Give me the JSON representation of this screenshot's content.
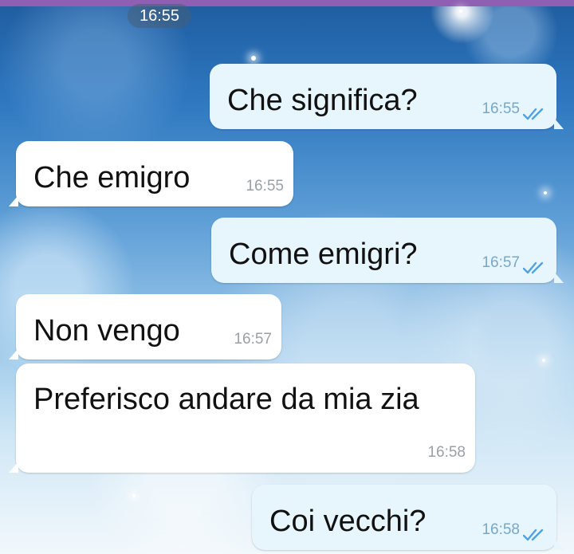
{
  "date_pill": "16:55",
  "messages": [
    {
      "text": "Che significa?",
      "time": "16:55",
      "direction": "out",
      "status": "read"
    },
    {
      "text": "Che emigro",
      "time": "16:55",
      "direction": "in"
    },
    {
      "text": "Come emigri?",
      "time": "16:57",
      "direction": "out",
      "status": "read"
    },
    {
      "text": "Non vengo",
      "time": "16:57",
      "direction": "in"
    },
    {
      "text": "Preferisco andare da mia zia",
      "time": "16:58",
      "direction": "in"
    },
    {
      "text": "Coi vecchi?",
      "time": "16:58",
      "direction": "out",
      "status": "read"
    }
  ],
  "icons": {
    "read_receipt": "double-check-icon"
  },
  "colors": {
    "incoming_bubble": "#ffffff",
    "outgoing_bubble": "#e7f5fd",
    "check": "#4fa3e0",
    "top_bar": "#8e5fb2"
  }
}
